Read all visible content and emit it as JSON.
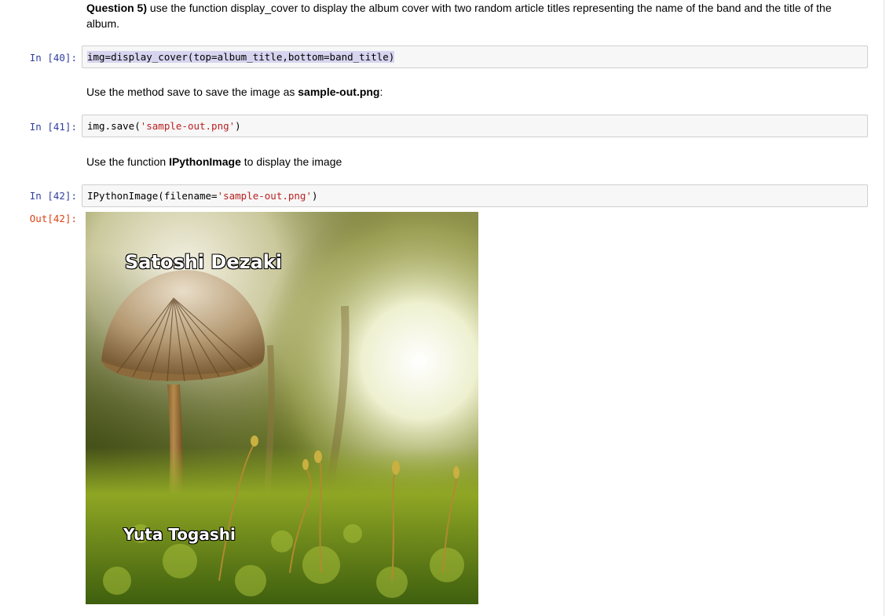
{
  "cells": {
    "q5": {
      "bold": "Question 5)",
      "text": " use the function display_cover to display the album cover with two random article titles representing the name of the band and the title of the album."
    },
    "in40": {
      "prompt": "In [40]:",
      "code": "img=display_cover(top=album_title,bottom=band_title)"
    },
    "md_save": {
      "before": "Use the method save to save the image as ",
      "bold": "sample-out.png",
      "after": ":"
    },
    "in41": {
      "prompt": "In [41]:",
      "code_a": "img.save(",
      "code_str": "'sample-out.png'",
      "code_b": ")"
    },
    "md_display": {
      "before": "Use the function ",
      "bold": "IPythonImage",
      "after": " to display the image"
    },
    "in42": {
      "prompt": "In [42]:",
      "code_a": "IPythonImage(filename=",
      "code_str": "'sample-out.png'",
      "code_b": ")"
    },
    "out42": {
      "prompt": "Out[42]:",
      "top_title": "Satoshi Dezaki",
      "bottom_title": "Yuta Togashi"
    }
  },
  "colors": {
    "in_prompt": "#303F9F",
    "out_prompt": "#D84315",
    "string": "#BA2121",
    "code_bg": "#f7f7f7"
  }
}
